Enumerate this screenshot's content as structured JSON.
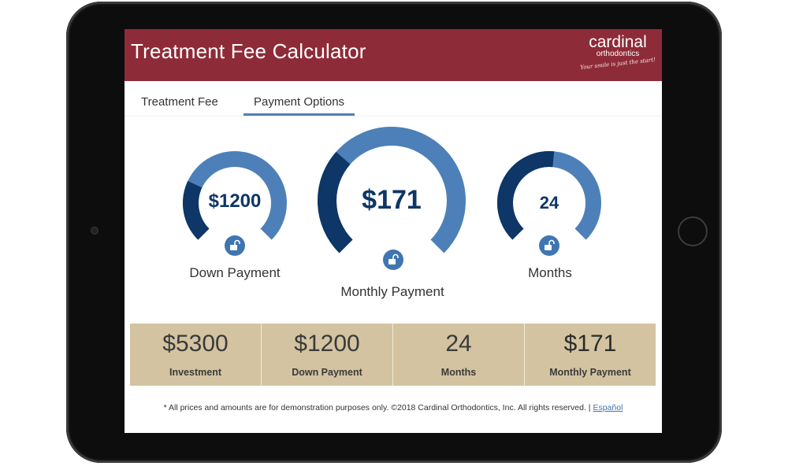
{
  "header": {
    "title": "Treatment Fee Calculator",
    "logo": {
      "name": "cardinal",
      "subtitle": "orthodontics",
      "tagline": "Your smile is just the start!"
    }
  },
  "tabs": [
    {
      "label": "Treatment Fee",
      "active": false
    },
    {
      "label": "Payment Options",
      "active": true
    }
  ],
  "gauges": {
    "down_payment": {
      "value": "$1200",
      "label": "Down Payment",
      "fill_fraction": 0.26,
      "locked": false
    },
    "monthly_payment": {
      "value": "$171",
      "label": "Monthly Payment",
      "fill_fraction": 0.32,
      "locked": false
    },
    "months": {
      "value": "24",
      "label": "Months",
      "fill_fraction": 0.52,
      "locked": false
    }
  },
  "summary": [
    {
      "value": "$5300",
      "label": "Investment"
    },
    {
      "value": "$1200",
      "label": "Down Payment"
    },
    {
      "value": "24",
      "label": "Months"
    },
    {
      "value": "$171",
      "label": "Monthly Payment"
    }
  ],
  "footer": {
    "disclaimer": "* All prices and amounts are for demonstration purposes only. ©2018 Cardinal Orthodontics, Inc. All rights reserved. | ",
    "link": "Español"
  },
  "colors": {
    "header_bg": "#8e2b38",
    "gauge_light": "#4d80b8",
    "gauge_dark": "#0e3666",
    "tab_underline": "#4d80b8",
    "summary_bg": "#d3c3a0"
  }
}
